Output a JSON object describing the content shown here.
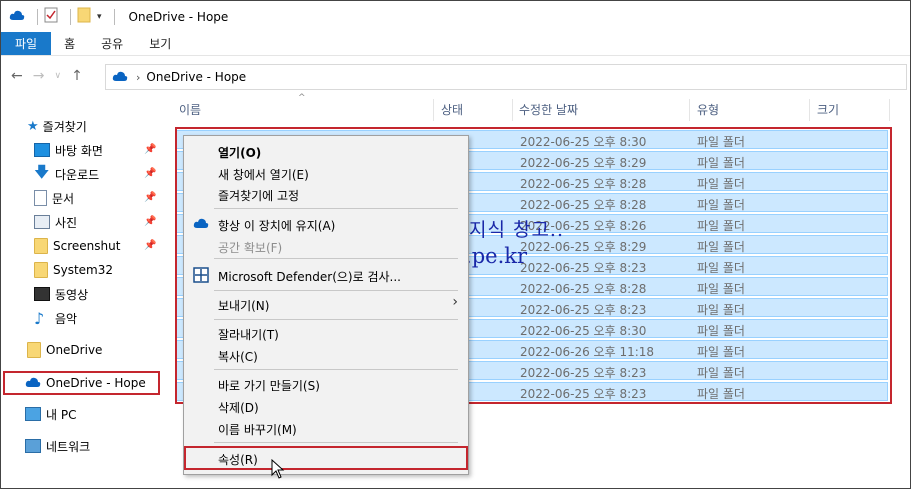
{
  "window": {
    "title": "OneDrive - Hope"
  },
  "ribbon": {
    "tabs": [
      "파일",
      "홈",
      "공유",
      "보기"
    ]
  },
  "address": {
    "path": "OneDrive - Hope"
  },
  "navpane": {
    "quick_access": "즐겨찾기",
    "items": [
      {
        "label": "바탕 화면",
        "icon": "desktop-icon",
        "pinned": true
      },
      {
        "label": "다운로드",
        "icon": "download-icon",
        "pinned": true
      },
      {
        "label": "문서",
        "icon": "document-icon",
        "pinned": true
      },
      {
        "label": "사진",
        "icon": "pictures-icon",
        "pinned": true
      },
      {
        "label": "Screenshut",
        "icon": "folder-icon",
        "pinned": true
      },
      {
        "label": "System32",
        "icon": "folder-icon",
        "pinned": false
      },
      {
        "label": "동영상",
        "icon": "video-icon",
        "pinned": false
      },
      {
        "label": "음악",
        "icon": "music-icon",
        "pinned": false
      }
    ],
    "onedrive": "OneDrive",
    "onedrive_hope": "OneDrive - Hope",
    "this_pc": "내 PC",
    "network": "네트워크"
  },
  "columns": {
    "name": "이름",
    "status": "상태",
    "modified": "수정한 날짜",
    "type": "유형",
    "size": "크기"
  },
  "rows": [
    {
      "date": "2022-06-25 오후 8:30",
      "type": "파일 폴더"
    },
    {
      "date": "2022-06-25 오후 8:29",
      "type": "파일 폴더"
    },
    {
      "date": "2022-06-25 오후 8:28",
      "type": "파일 폴더"
    },
    {
      "date": "2022-06-25 오후 8:28",
      "type": "파일 폴더"
    },
    {
      "date": "2022-06-25 오후 8:26",
      "type": "파일 폴더"
    },
    {
      "date": "2022-06-25 오후 8:29",
      "type": "파일 폴더"
    },
    {
      "date": "2022-06-25 오후 8:23",
      "type": "파일 폴더"
    },
    {
      "date": "2022-06-25 오후 8:28",
      "type": "파일 폴더"
    },
    {
      "date": "2022-06-25 오후 8:23",
      "type": "파일 폴더"
    },
    {
      "date": "2022-06-25 오후 8:30",
      "type": "파일 폴더"
    },
    {
      "date": "2022-06-26 오후 11:18",
      "type": "파일 폴더"
    },
    {
      "date": "2022-06-25 오후 8:23",
      "type": "파일 폴더"
    },
    {
      "date": "2022-06-25 오후 8:23",
      "type": "파일 폴더"
    }
  ],
  "context_menu": {
    "open": "열기(O)",
    "open_new_window": "새 창에서 열기(E)",
    "pin_quick": "즐겨찾기에 고정",
    "keep_on_device": "항상 이 장치에 유지(A)",
    "free_space": "공간 확보(F)",
    "defender": "Microsoft Defender(으)로 검사...",
    "send_to": "보내기(N)",
    "cut": "잘라내기(T)",
    "copy": "복사(C)",
    "shortcut": "바로 가기 만들기(S)",
    "delete": "삭제(D)",
    "rename": "이름 바꾸기(M)",
    "properties": "속성(R)"
  },
  "watermark": {
    "line1": "준범이의 지식 창고..",
    "line2": "hope.pe.kr"
  },
  "colors": {
    "accent": "#1979ca",
    "selection": "#cce8ff",
    "highlight_border": "#c4262e",
    "watermark": "#1a28a8"
  }
}
